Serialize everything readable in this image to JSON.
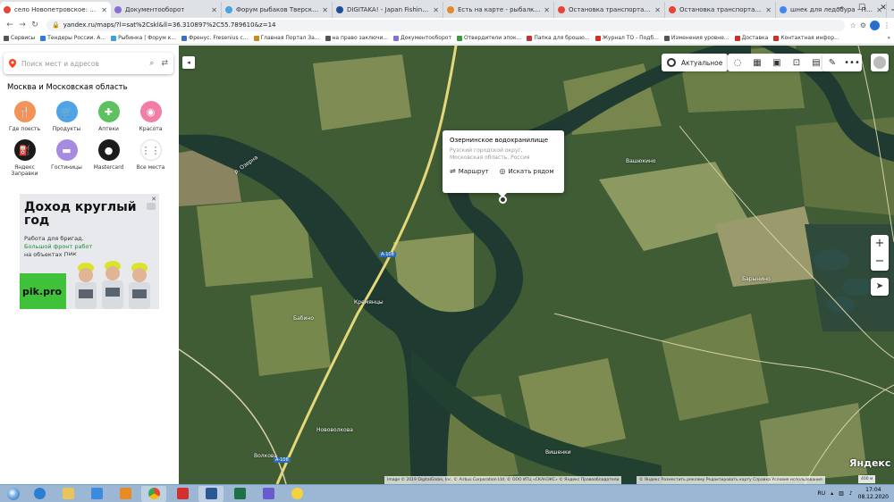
{
  "browser": {
    "tabs": [
      {
        "title": "село Новопетровское: как доб",
        "active": true,
        "color": "#e94335"
      },
      {
        "title": "Документооборот",
        "active": false,
        "color": "#8a6fd1"
      },
      {
        "title": "Форум рыбаков Тверской обла",
        "active": false,
        "color": "#4aa3df"
      },
      {
        "title": "DIGITAKA! - Japan Fishing Tackle",
        "active": false,
        "color": "#1b4f9c"
      },
      {
        "title": "Есть на карте - рыбалка в Крас",
        "active": false,
        "color": "#e08a2c"
      },
      {
        "title": "Остановка транспорта Первос",
        "active": false,
        "color": "#e94335"
      },
      {
        "title": "Остановка транспорта Первое",
        "active": false,
        "color": "#e94335"
      },
      {
        "title": "шнек для ледобура - Поиск в G",
        "active": false,
        "color": "#4285f4"
      }
    ],
    "url": "yandex.ru/maps/?l=sat%2Cskl&ll=36.310897%2C55.789610&z=14",
    "profile_initial": "И",
    "bookmarks": [
      {
        "label": "Сервисы",
        "color": "#555"
      },
      {
        "label": "Тендеры России. А...",
        "color": "#2d7de0"
      },
      {
        "label": "Рыбинка | Форум к...",
        "color": "#3aa0e0"
      },
      {
        "label": "Френус. Fresenius с...",
        "color": "#3a6fd0"
      },
      {
        "label": "Главная Портал За...",
        "color": "#c88a20"
      },
      {
        "label": "на право заключи...",
        "color": "#555"
      },
      {
        "label": "Документооборот",
        "color": "#8a6fd1"
      },
      {
        "label": "Отвердители эпок...",
        "color": "#3a9b3a"
      },
      {
        "label": "Папка для брошю...",
        "color": "#c8322a"
      },
      {
        "label": "Журнал ТО - Подб...",
        "color": "#c8322a"
      },
      {
        "label": "Изменения уровне...",
        "color": "#555"
      },
      {
        "label": "Доставка",
        "color": "#c8322a"
      },
      {
        "label": "Контактная инфор...",
        "color": "#c8322a"
      }
    ],
    "more_bookmarks": "»"
  },
  "sidebar": {
    "search_placeholder": "Поиск мест и адресов",
    "region_title": "Москва и Московская область",
    "categories": [
      {
        "label": "Где поесть",
        "color": "#f59257",
        "icon": "fork-knife-icon",
        "glyph": "🍴"
      },
      {
        "label": "Продукты",
        "color": "#4da5e8",
        "icon": "basket-icon",
        "glyph": "🛒"
      },
      {
        "label": "Аптеки",
        "color": "#5fc05f",
        "icon": "plus-icon",
        "glyph": "✚"
      },
      {
        "label": "Красота",
        "color": "#f27ea8",
        "icon": "lips-icon",
        "glyph": "◉"
      },
      {
        "label": "Яндекс Заправки",
        "color": "#1b1b1b",
        "icon": "fuel-icon",
        "glyph": "⛽"
      },
      {
        "label": "Гостиницы",
        "color": "#a78be0",
        "icon": "bed-icon",
        "glyph": "▬"
      },
      {
        "label": "Mastercard",
        "color": "#1b1b1b",
        "icon": "mastercard-icon",
        "glyph": "●"
      },
      {
        "label": "Все места",
        "color": "#ffffff",
        "icon": "grid-icon",
        "glyph": "⋮⋮"
      }
    ],
    "ad": {
      "headline": "Доход круглый год",
      "text_line1": "Работа для бригад.",
      "text_green": "Большой фронт работ",
      "text_line3": "на объектах ПИК",
      "logo": "pik.pro"
    }
  },
  "map": {
    "layer_button": "Актуальное",
    "popup": {
      "title": "Озернинское водохранилище",
      "subtitle": "Рузский городской округ, Московская область, Россия",
      "route_label": "Маршрут",
      "nearby_label": "Искать рядом"
    },
    "place_labels": [
      "Вашюкино",
      "Барынино",
      "Бабино",
      "Кремянцы",
      "Нововолкова",
      "Вишенки",
      "Волкова",
      "Вашюкино"
    ],
    "road_labels": [
      "А-108",
      "А-108"
    ],
    "river_label": "р. Озерна",
    "copyright_1": "Image © 2019 DigitalGlobe, Inc. © Airbus Corporation Ltd. © ООО ИТЦ «СКАНЭКС» © Яндекс   Правообладатели",
    "copyright_2": "© Яндекс   Разместить рекламу   Редактировать карту   Справка   Условия использования",
    "brand": "Яндекс",
    "scale": "400 м",
    "zoom_in": "+",
    "zoom_out": "−"
  },
  "taskbar": {
    "lang": "RU",
    "time": "17:04",
    "date": "08.12.2020"
  }
}
